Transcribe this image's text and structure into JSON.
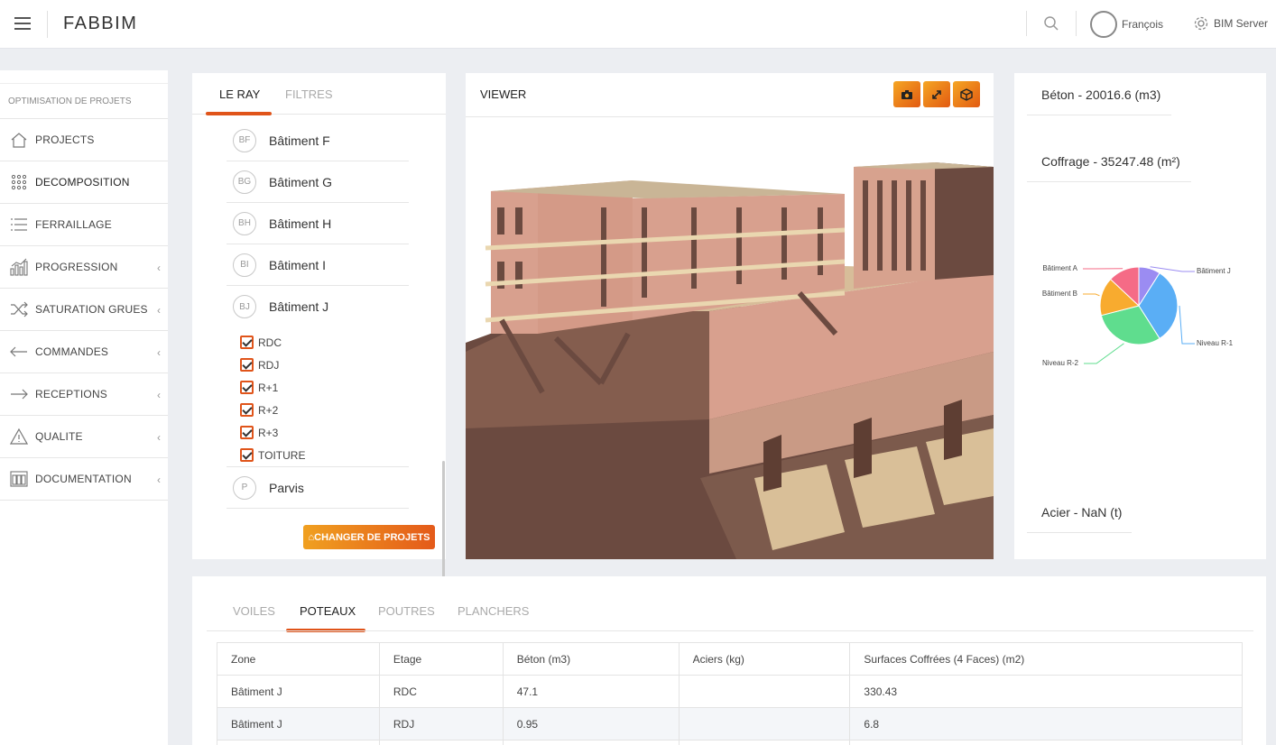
{
  "app": {
    "brand": "FABBIM",
    "user_name": "François",
    "server_label": "BIM Server"
  },
  "sidebar": {
    "section_title": "OPTIMISATION DE PROJETS",
    "items": [
      {
        "label": "PROJECTS",
        "icon": "home-icon",
        "chevron": false
      },
      {
        "label": "DECOMPOSITION",
        "icon": "grid-dots-icon",
        "chevron": false
      },
      {
        "label": "FERRAILLAGE",
        "icon": "list-icon",
        "chevron": false
      },
      {
        "label": "PROGRESSION",
        "icon": "bar-chart-icon",
        "chevron": true
      },
      {
        "label": "SATURATION GRUES",
        "icon": "shuffle-icon",
        "chevron": true
      },
      {
        "label": "COMMANDES",
        "icon": "arrow-left-icon",
        "chevron": true
      },
      {
        "label": "RECEPTIONS",
        "icon": "arrow-right-icon",
        "chevron": true
      },
      {
        "label": "QUALITE",
        "icon": "warning-icon",
        "chevron": true
      },
      {
        "label": "DOCUMENTATION",
        "icon": "columns-icon",
        "chevron": true
      }
    ]
  },
  "left_panel": {
    "tabs": [
      "LE RAY",
      "FILTRES"
    ],
    "buildings": [
      {
        "abbr": "BF",
        "name": "Bâtiment F"
      },
      {
        "abbr": "BG",
        "name": "Bâtiment G"
      },
      {
        "abbr": "BH",
        "name": "Bâtiment H"
      },
      {
        "abbr": "BI",
        "name": "Bâtiment I"
      },
      {
        "abbr": "BJ",
        "name": "Bâtiment J"
      }
    ],
    "levels": [
      "RDC",
      "RDJ",
      "R+1",
      "R+2",
      "R+3",
      "TOITURE"
    ],
    "last_building": {
      "abbr": "P",
      "name": "Parvis"
    },
    "change_button": "CHANGER DE PROJETS"
  },
  "viewer": {
    "title": "VIEWER",
    "buttons": [
      "camera-icon",
      "expand-icon",
      "cube-icon"
    ]
  },
  "stats": {
    "beton": "Béton - 20016.6 (m3)",
    "coffrage": "Coffrage - 35247.48 (m²)",
    "acier": "Acier - NaN (t)",
    "pie": {
      "slices": [
        {
          "label": "Bâtiment J",
          "value": 9,
          "color": "#9b8cf2"
        },
        {
          "label": "Niveau R-1",
          "value": 32,
          "color": "#5aaef5"
        },
        {
          "label": "Niveau R-2",
          "value": 30,
          "color": "#5fdd8e"
        },
        {
          "label": "Bâtiment B",
          "value": 16,
          "color": "#f8ab2f"
        },
        {
          "label": "Bâtiment A",
          "value": 13,
          "color": "#f56b86"
        }
      ]
    }
  },
  "bottom": {
    "tabs": [
      "VOILES",
      "POTEAUX",
      "POUTRES",
      "PLANCHERS"
    ],
    "columns": [
      "Zone",
      "Etage",
      "Béton (m3)",
      "Aciers (kg)",
      "Surfaces Coffrées (4 Faces) (m2)"
    ],
    "rows": [
      [
        "Bâtiment J",
        "RDC",
        "47.1",
        "",
        "330.43"
      ],
      [
        "Bâtiment J",
        "RDJ",
        "0.95",
        "",
        "6.8"
      ],
      [
        "",
        "",
        "",
        "",
        ""
      ]
    ]
  }
}
